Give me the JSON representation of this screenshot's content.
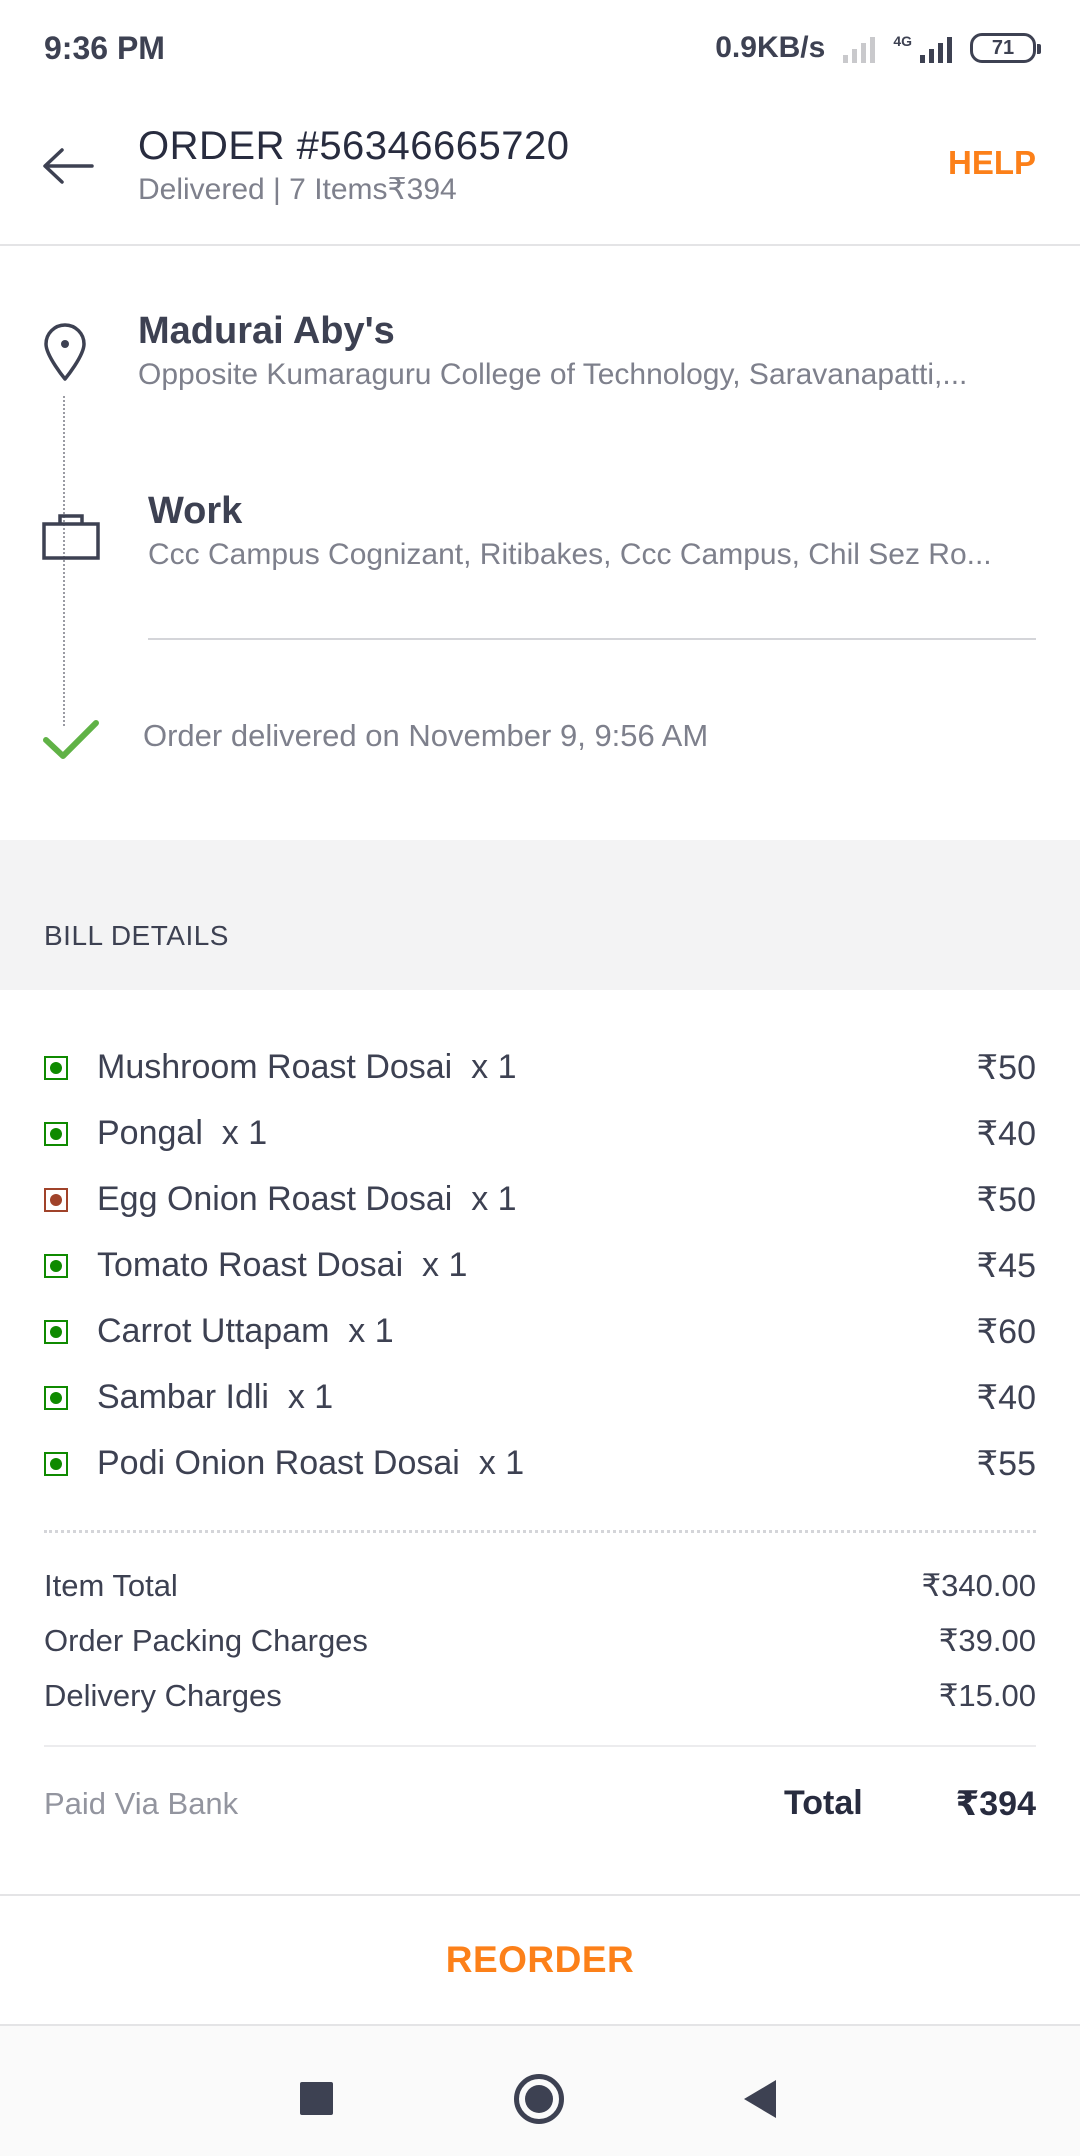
{
  "status_bar": {
    "time": "9:36 PM",
    "speed": "0.9KB/s",
    "network": "4G",
    "battery": "71"
  },
  "header": {
    "title": "ORDER #56346665720",
    "subtitle": "Delivered | 7 Items₹394",
    "help_label": "HELP",
    "back_icon": "arrow-left-icon"
  },
  "route": {
    "restaurant": {
      "name": "Madurai Aby's",
      "address": "Opposite Kumaraguru College of Technology, Saravanapatti,..."
    },
    "destination": {
      "label": "Work",
      "address": "Ccc Campus Cognizant, Ritibakes, Ccc Campus, Chil Sez Ro..."
    },
    "status": "Order delivered on November 9, 9:56 AM"
  },
  "bill": {
    "title": "BILL DETAILS",
    "items": [
      {
        "name": "Mushroom Roast Dosai  x 1",
        "price": "₹50",
        "type": "veg"
      },
      {
        "name": "Pongal  x 1",
        "price": "₹40",
        "type": "veg"
      },
      {
        "name": "Egg Onion Roast Dosai  x 1",
        "price": "₹50",
        "type": "nonveg"
      },
      {
        "name": "Tomato Roast Dosai  x 1",
        "price": "₹45",
        "type": "veg"
      },
      {
        "name": "Carrot Uttapam  x 1",
        "price": "₹60",
        "type": "veg"
      },
      {
        "name": "Sambar Idli  x 1",
        "price": "₹40",
        "type": "veg"
      },
      {
        "name": "Podi Onion Roast Dosai  x 1",
        "price": "₹55",
        "type": "veg"
      }
    ],
    "charges": [
      {
        "label": "Item Total",
        "value": "₹340.00"
      },
      {
        "label": "Order Packing Charges",
        "value": "₹39.00"
      },
      {
        "label": "Delivery Charges",
        "value": "₹15.00"
      }
    ],
    "paid_via": "Paid Via Bank",
    "total_label": "Total",
    "total_value": "₹394"
  },
  "reorder_label": "REORDER",
  "colors": {
    "accent": "#fc8019",
    "veg": "#0f8a00",
    "nonveg": "#a0432a",
    "check": "#60b246"
  }
}
